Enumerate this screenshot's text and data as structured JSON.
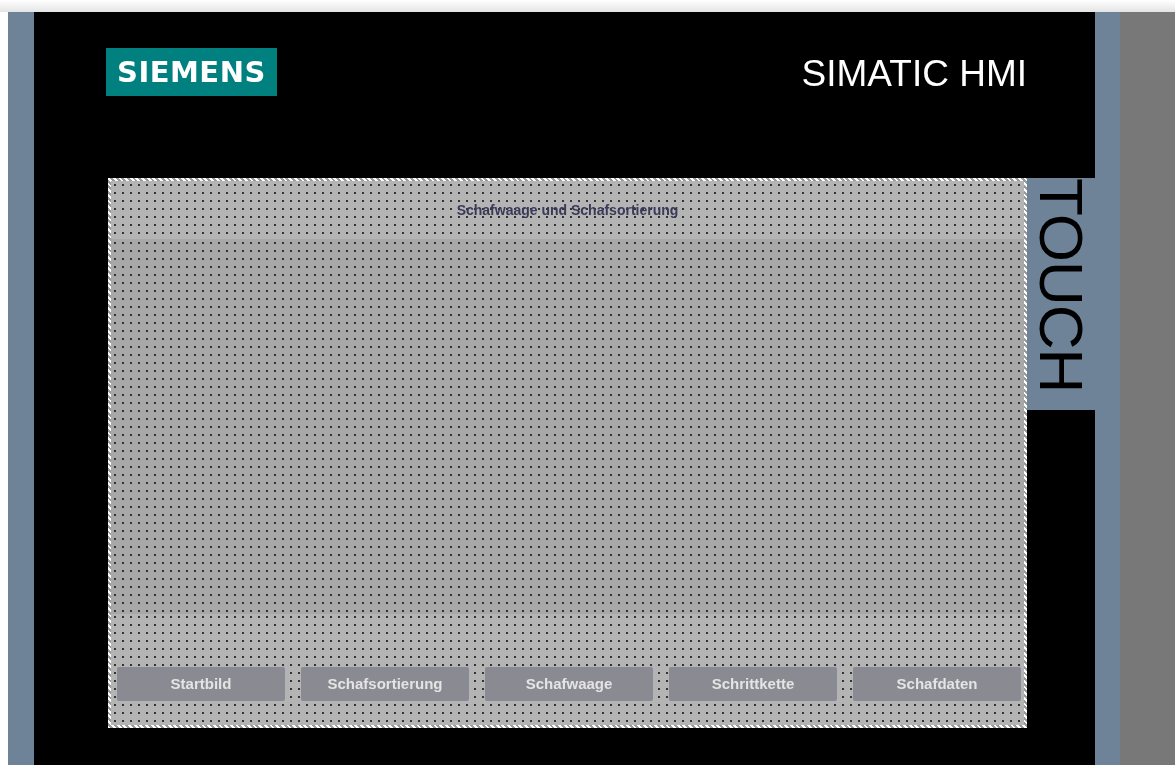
{
  "header": {
    "logo": "SIEMENS",
    "product": "SIMATIC HMI"
  },
  "side_label": "TOUCH",
  "screen": {
    "title": "Schafwaage und Schafsortierung",
    "buttons": [
      "Startbild",
      "Schafsortierung",
      "Schafwaage",
      "Schrittkette",
      "Schafdaten"
    ]
  }
}
